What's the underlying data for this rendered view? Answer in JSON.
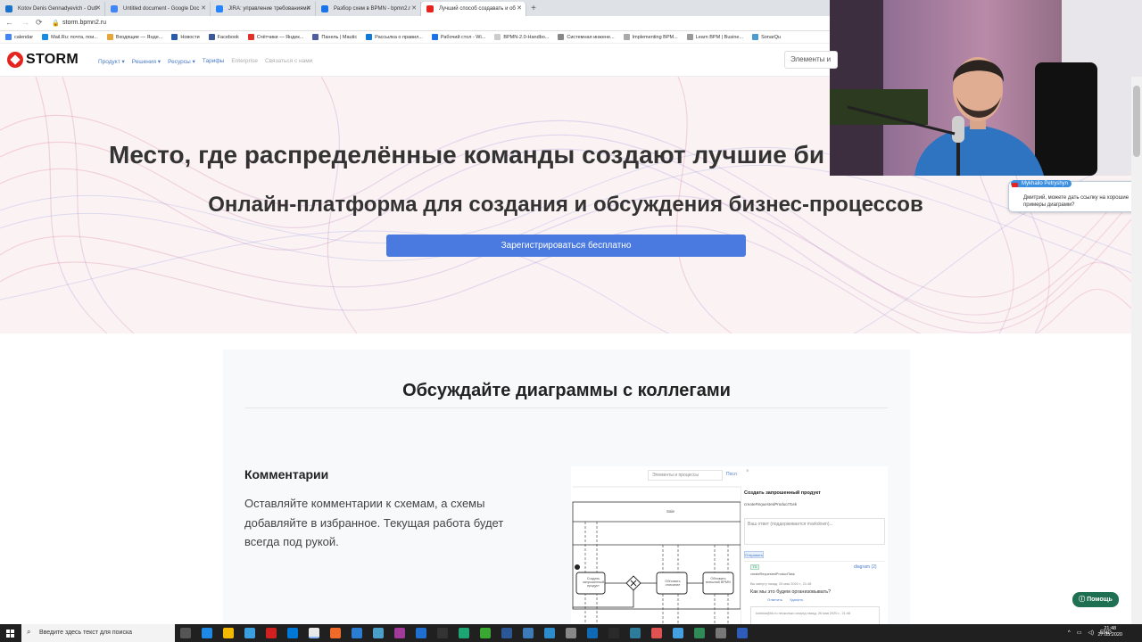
{
  "browser": {
    "tabs": [
      {
        "label": "Kotov Denis Gennadyevich - Outl",
        "color": "#1a73c8",
        "active": false
      },
      {
        "label": "Untitled document - Google Doc",
        "color": "#4285f4",
        "active": false
      },
      {
        "label": "JIRA: управление требованиями",
        "color": "#2684ff",
        "active": false
      },
      {
        "label": "Разбор схем в BPMN - bpmn2.r",
        "color": "#1a73e8",
        "active": false
      },
      {
        "label": "Лучший способ создавать и об",
        "color": "#e52420",
        "active": true
      }
    ],
    "url": "storm.bpmn2.ru",
    "bookmarks": [
      {
        "label": "calendar",
        "color": "#4285f4"
      },
      {
        "label": "Mail.Ru: почта, пои...",
        "color": "#168de2"
      },
      {
        "label": "Входящие — Янде...",
        "color": "#e8a53a"
      },
      {
        "label": "Новости",
        "color": "#2a5ba8"
      },
      {
        "label": "Facebook",
        "color": "#3b5998"
      },
      {
        "label": "Счётчики — Яндек...",
        "color": "#e5302a"
      },
      {
        "label": "Панель | Mautic",
        "color": "#4e5e9e"
      },
      {
        "label": "Рассылка о правил...",
        "color": "#0f7ad8"
      },
      {
        "label": "Рабочий стол - Wi...",
        "color": "#1a73e8"
      },
      {
        "label": "BPMN-2.0-Handbo...",
        "color": "#ccc"
      },
      {
        "label": "Системная инжене...",
        "color": "#888"
      },
      {
        "label": "Implementing BPM...",
        "color": "#aaa"
      },
      {
        "label": "Learn BPM | Busine...",
        "color": "#999"
      },
      {
        "label": "SonarQu",
        "color": "#4e9bcd"
      }
    ]
  },
  "site": {
    "logo_text": "STORM",
    "nav": [
      {
        "label": "Продукт ▾",
        "dim": false
      },
      {
        "label": "Решения ▾",
        "dim": false
      },
      {
        "label": "Ресурсы ▾",
        "dim": false
      },
      {
        "label": "Тарифы",
        "dim": false
      },
      {
        "label": "Enterprise",
        "dim": true
      },
      {
        "label": "Связаться с нами",
        "dim": true
      }
    ],
    "search_placeholder": "Элементы и",
    "hero_title": "Место, где распределённые команды создают лучшие би",
    "hero_subtitle": "Онлайн-платформа для создания и обсуждения бизнес-процессов",
    "cta_label": "Зарегистрироваться бесплатно",
    "section_title": "Обсуждайте диаграммы с коллегами",
    "feature_title": "Комментарии",
    "feature_text": "Оставляйте комментарии к схемам, а схемы добавляйте в избранное. Текущая работа будет всегда под рукой.",
    "help_label": "Помощь"
  },
  "preview": {
    "search_placeholder": "Элементы и процессы",
    "search_more": "Посл",
    "close": "×",
    "pool_label": "Sale",
    "tasks": [
      "Создать запрошенный продукт",
      "Обновить описание",
      "Обновить внешний BPMN"
    ],
    "panel_title": "Создать запрошенный продукт",
    "panel_id": "createRequestedProductTask",
    "comment_placeholder": "Ваш ответ (поддерживается markdown)...",
    "button_label": "Отправить",
    "tag": "TG",
    "element_ref": "createRequestedProductTask",
    "diagram_link": "diagram (2)",
    "comment_meta": "Вы минуту назад, 26 мая 2020 г., 21:48",
    "comment_text": "Как мы это будем организовывать?",
    "reply": "Ответить",
    "delete": "Удалить",
    "comment2_meta": "korkina@bk.ru несколько секунд назад, 26 мая 2020 г., 21:48"
  },
  "chat": {
    "name": "Mykhailo Petryshyn",
    "message": "Дмитрий, можете дать ссылку на хорошие примеры диаграмм?"
  },
  "taskbar": {
    "search_placeholder": "Введите здесь текст для поиска",
    "lang": "ENG",
    "time": "21:48",
    "date": "27.05.2020"
  }
}
